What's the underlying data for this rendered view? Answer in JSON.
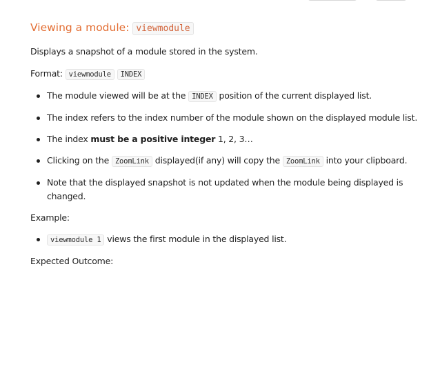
{
  "heading": {
    "text": "Viewing a module:",
    "command": "viewmodule"
  },
  "description": "Displays a snapshot of a module stored in the system.",
  "format": {
    "label": "Format:",
    "command": "viewmodule",
    "param": "INDEX"
  },
  "bullets": {
    "b1": {
      "pre": "The module viewed will be at the",
      "code": "INDEX",
      "post": "position of the current displayed list."
    },
    "b2": {
      "text": "The index refers to the index number of the module shown on the displayed module list."
    },
    "b3": {
      "pre": "The index",
      "bold": "must be a positive integer",
      "post": "1, 2, 3…"
    },
    "b4": {
      "pre": "Clicking on the",
      "code1": "ZoomLink",
      "mid": "displayed(if any) will copy the",
      "code2": "ZoomLink",
      "post": "into your clipboard."
    },
    "b5": {
      "text": "Note that the displayed snapshot is not updated when the module being displayed is changed."
    }
  },
  "example": {
    "label": "Example:",
    "code": "viewmodule 1",
    "text": "views the first module in the displayed list."
  },
  "outcome": {
    "label": "Expected Outcome:"
  }
}
